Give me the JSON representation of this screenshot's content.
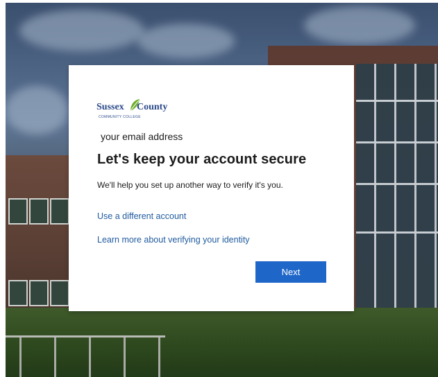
{
  "logo": {
    "word_left": "Sussex",
    "word_right": "County",
    "subtitle": "COMMUNITY COLLEGE"
  },
  "account": {
    "email": "your email address"
  },
  "heading": "Let's keep your account secure",
  "description": "We'll help you set up another way to verify it's you.",
  "links": {
    "different_account": "Use a different account",
    "learn_more": "Learn more about verifying your identity"
  },
  "buttons": {
    "next": "Next"
  },
  "colors": {
    "accent": "#1f66c9",
    "link": "#1f5a9e",
    "brand": "#2c4a8a",
    "leaf": "#6fae2f"
  }
}
